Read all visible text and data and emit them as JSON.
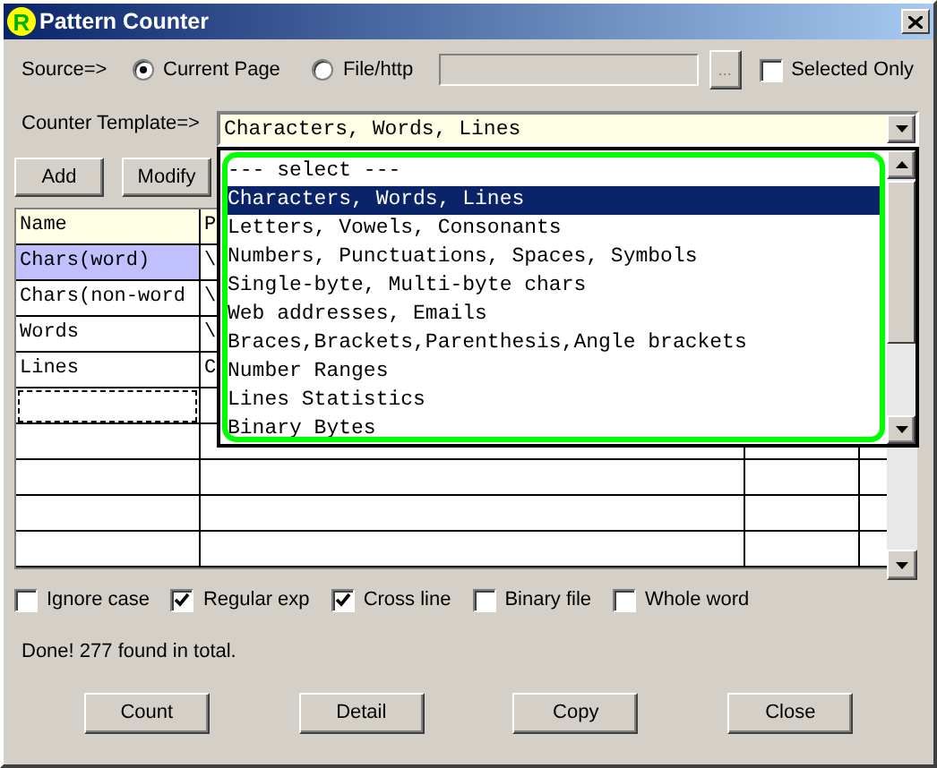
{
  "window": {
    "title": "Pattern Counter",
    "logo": "R"
  },
  "source": {
    "label": "Source=>",
    "options": [
      {
        "label": "Current Page",
        "selected": true
      },
      {
        "label": "File/http",
        "selected": false
      }
    ],
    "browse_button": "...",
    "selected_only": {
      "label": "Selected Only",
      "checked": false
    }
  },
  "template": {
    "label": "Counter Template=>",
    "value": "Characters, Words, Lines",
    "options": [
      {
        "label": "--- select ---",
        "selected": false
      },
      {
        "label": "Characters, Words, Lines",
        "selected": true
      },
      {
        "label": "Letters, Vowels, Consonants",
        "selected": false
      },
      {
        "label": "Numbers, Punctuations, Spaces, Symbols",
        "selected": false
      },
      {
        "label": "Single-byte, Multi-byte chars",
        "selected": false
      },
      {
        "label": "Web addresses, Emails",
        "selected": false
      },
      {
        "label": "Braces,Brackets,Parenthesis,Angle brackets",
        "selected": false
      },
      {
        "label": "Number Ranges",
        "selected": false
      },
      {
        "label": "Lines Statistics",
        "selected": false
      },
      {
        "label": "Binary Bytes",
        "selected": false
      }
    ]
  },
  "buttons": [
    "Add",
    "Modify"
  ],
  "table": {
    "columns": [
      "Name",
      "P"
    ],
    "rows": [
      {
        "cells": [
          "Chars(word)",
          "\\"
        ],
        "selected": true,
        "focused": false
      },
      {
        "cells": [
          "Chars(non-word",
          "\\"
        ],
        "selected": false,
        "focused": false
      },
      {
        "cells": [
          "Words",
          "\\"
        ],
        "selected": false,
        "focused": false
      },
      {
        "cells": [
          "Lines",
          "C"
        ],
        "selected": false,
        "focused": false
      },
      {
        "selected": false,
        "focused": true
      }
    ]
  },
  "options": [
    {
      "label": "Ignore case",
      "checked": false
    },
    {
      "label": "Regular exp",
      "checked": true
    },
    {
      "label": "Cross line",
      "checked": true
    },
    {
      "label": "Binary file",
      "checked": false
    },
    {
      "label": "Whole word",
      "checked": false
    }
  ],
  "status": "Done! 277 found in total.",
  "actions": [
    "Count",
    "Detail",
    "Copy",
    "Close"
  ]
}
